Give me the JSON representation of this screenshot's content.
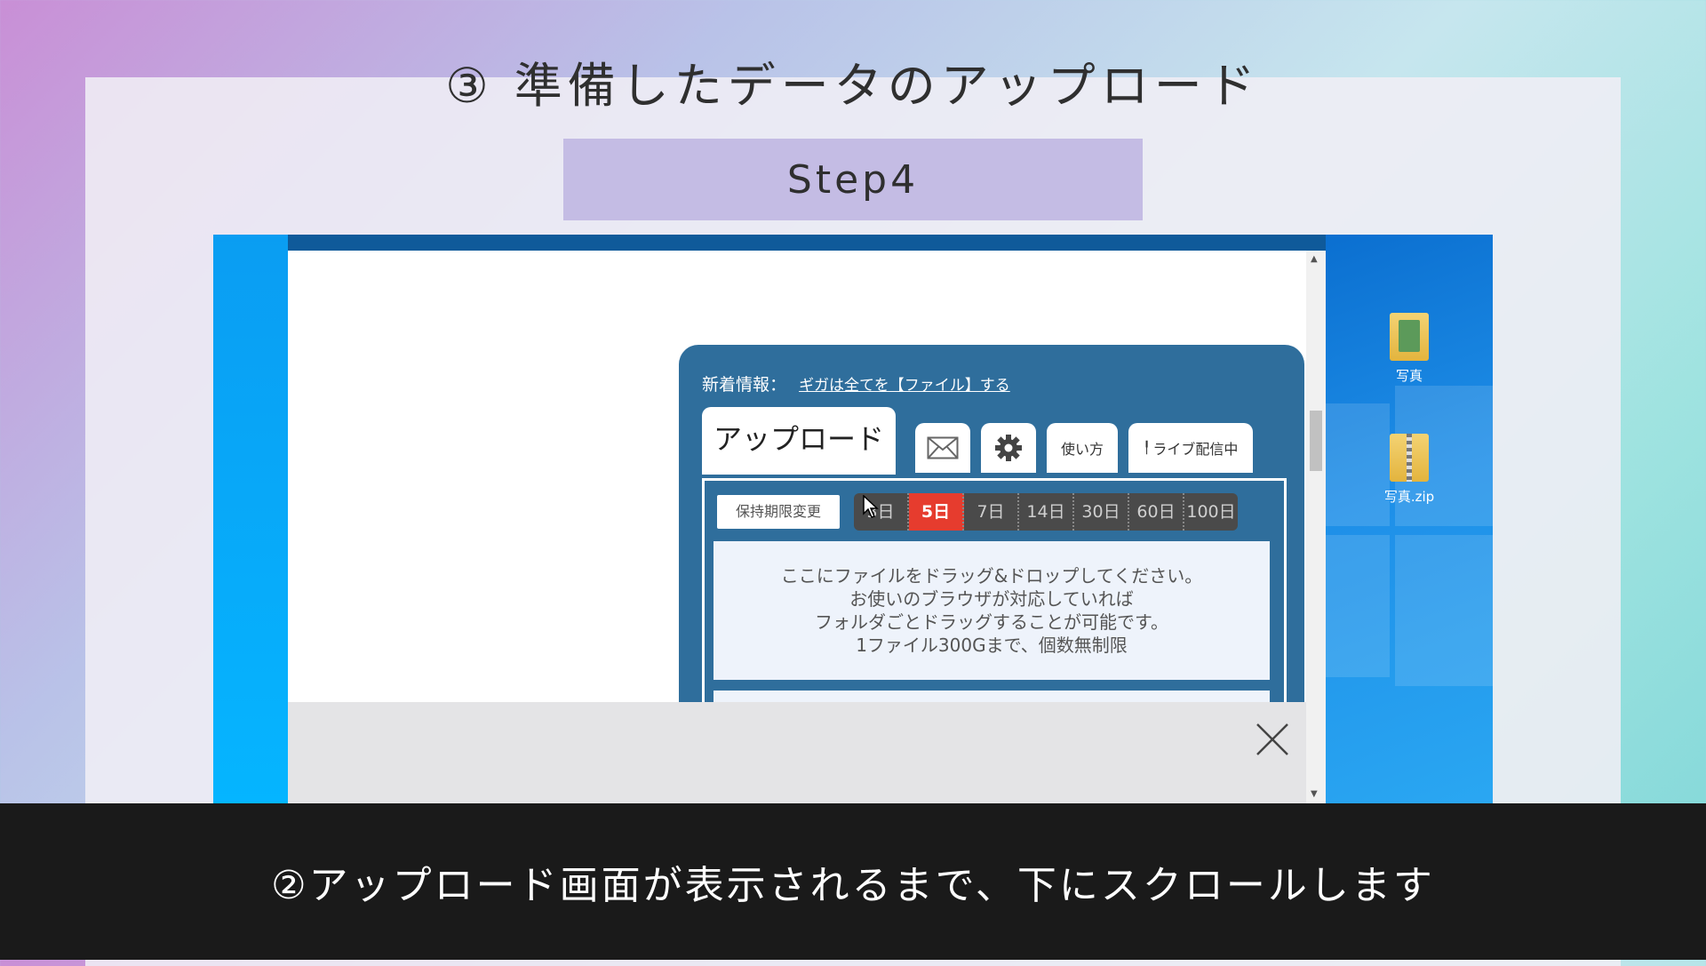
{
  "slide": {
    "title": "③ 準備したデータのアップロード",
    "step_label": "Step4",
    "caption": "②アップロード画面が表示されるまで、下にスクロールします"
  },
  "app": {
    "news_label": "新着情報：",
    "news_link": "ギガは全てを【ファイル】する",
    "tabs": {
      "upload": "アップロード",
      "mail_icon": "mail-icon",
      "settings_icon": "gear-icon",
      "howto": "使い方",
      "live": "ライブ配信中"
    },
    "period_button": "保持期限変更",
    "days": [
      "3日",
      "5日",
      "7日",
      "14日",
      "30日",
      "60日",
      "100日"
    ],
    "active_day": "5日",
    "drop_text": [
      "ここにファイルをドラッグ&ドロップしてください。",
      "お使いのブラウザが対応していれば",
      "フォルダごとドラッグすることが可能です。",
      "1ファイル300Gまで、個数無制限"
    ],
    "active_color": "#e63c2e"
  },
  "desktop": {
    "icons": [
      {
        "label": "写真",
        "icon": "folder-icon"
      },
      {
        "label": "写真.zip",
        "icon": "zip-folder-icon"
      }
    ]
  }
}
